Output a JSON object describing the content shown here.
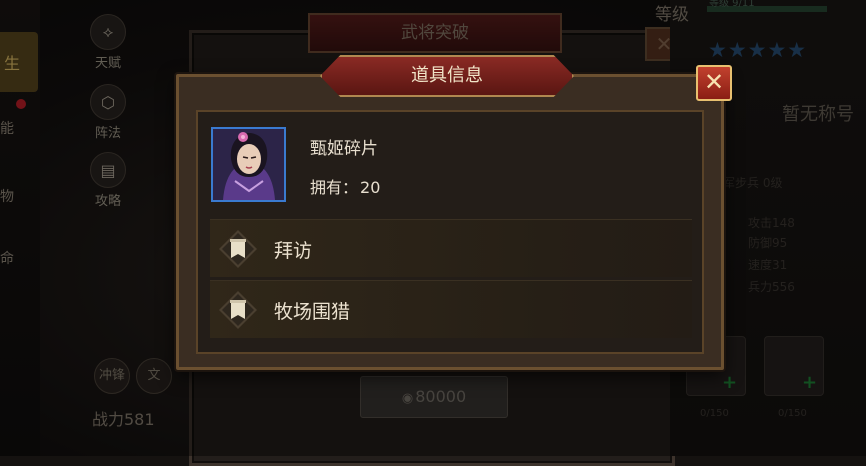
{
  "background": {
    "left_nav": [
      {
        "label": "天赋",
        "icon": "tree-icon"
      },
      {
        "label": "阵法",
        "icon": "hexagon-icon"
      },
      {
        "label": "攻略",
        "icon": "book-icon"
      }
    ],
    "left_edge_labels": [
      "能",
      "物",
      "命"
    ],
    "left_edge_tab": "生",
    "back_window_title": "武将突破",
    "back_close_glyph": "✕",
    "back_cost": "80000",
    "rank_label": "等级",
    "level_text": "等级 9/11",
    "stars": "★★★★★",
    "no_title": "暂无称号",
    "info_faint": "军步兵 0级",
    "stat_lines": [
      "攻击148",
      "防御95",
      "速度31",
      "兵力556"
    ],
    "slot_counts": [
      "0/150",
      "0/150"
    ],
    "bottom_badges": [
      "冲锋",
      "文"
    ],
    "power_label": "战力581"
  },
  "dialog": {
    "title": "道具信息",
    "close_glyph": "✕",
    "item": {
      "name": "甄姬碎片",
      "count_label": "拥有：",
      "count": "20",
      "portrait_icon": "character-portrait-icon"
    },
    "sources": [
      {
        "label": "拜访",
        "icon": "banner-icon"
      },
      {
        "label": "牧场围猎",
        "icon": "banner-icon"
      }
    ]
  },
  "colors": {
    "title_banner": "#7a2420",
    "frame_gold": "#b08850",
    "portrait_border": "#3a7ad0",
    "close_button": "#b8392a"
  }
}
